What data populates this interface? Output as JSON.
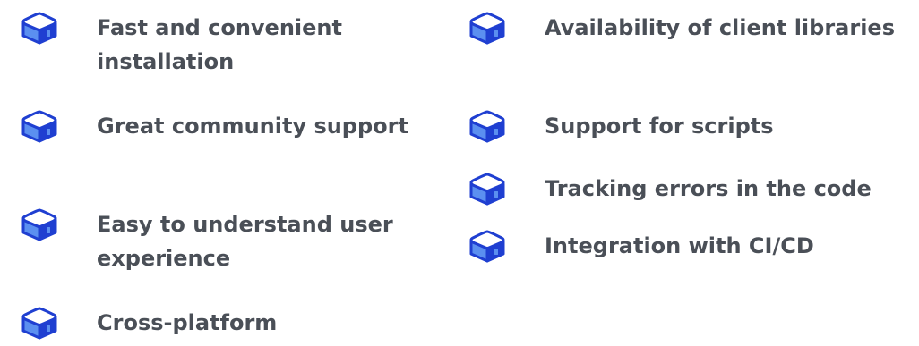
{
  "features": [
    {
      "label": "Fast and convenient installation",
      "icon": "box-icon"
    },
    {
      "label": "Great community support",
      "icon": "box-icon"
    },
    {
      "label": "Easy to understand user experience",
      "icon": "box-icon"
    },
    {
      "label": "Cross-platform",
      "icon": "box-icon"
    },
    {
      "label": "Availability of client libraries",
      "icon": "box-icon"
    },
    {
      "label": "Support for scripts",
      "icon": "box-icon"
    },
    {
      "label": "Tracking errors in the code",
      "icon": "box-icon"
    },
    {
      "label": "Integration with CI/CD",
      "icon": "box-icon"
    }
  ],
  "colors": {
    "icon_outline": "#1f3fd1",
    "icon_top": "#ffffff",
    "icon_side": "#5b8ff0",
    "text": "#4a4f57"
  }
}
